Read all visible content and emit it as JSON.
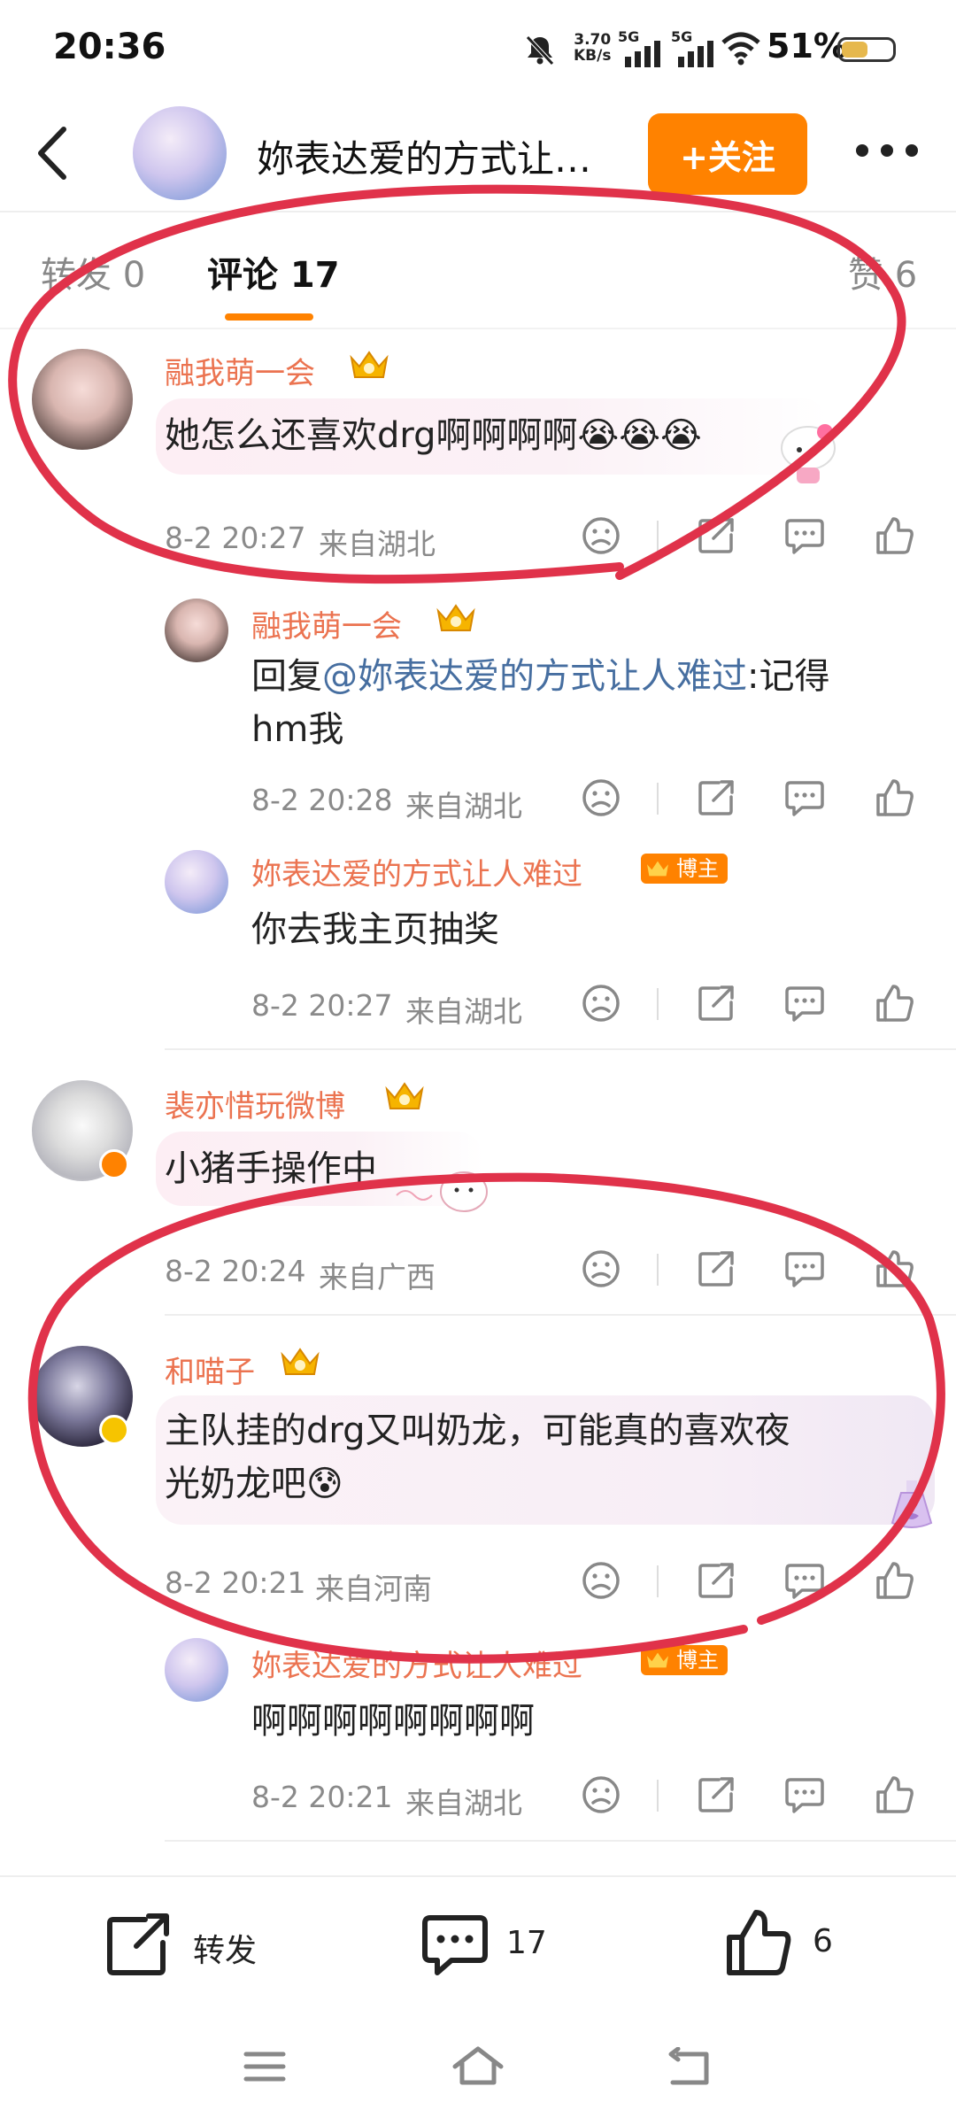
{
  "status_bar": {
    "time": "20:36",
    "net_speed_value": "3.70",
    "net_speed_unit": "KB/s",
    "signal1": "5G",
    "signal2": "5G",
    "battery": "51%",
    "battery_level": 0.51
  },
  "header": {
    "title": "妳表达爱的方式让…",
    "follow_label": "+关注"
  },
  "tabs": [
    {
      "label": "转发 0"
    },
    {
      "label": "评论 17"
    },
    {
      "label": "赞 6"
    }
  ],
  "comments": [
    {
      "name": "融我萌一会",
      "text": "她怎么还喜欢drg啊啊啊啊😭😭😭",
      "time": "8-2 20:27",
      "location": "来自湖北"
    },
    {
      "name": "融我萌一会",
      "reply_prefix": "回复",
      "mention": "@妳表达爱的方式让人难过",
      "text_line1": ":记得",
      "text_line2": "hm我",
      "time": "8-2 20:28",
      "location": "来自湖北"
    },
    {
      "name": "妳表达爱的方式让人难过",
      "badge": "博主",
      "text": "你去我主页抽奖",
      "time": "8-2 20:27",
      "location": "来自湖北"
    },
    {
      "name": "裴亦惜玩微博",
      "text": "小猪手操作中",
      "time": "8-2 20:24",
      "location": "来自广西"
    },
    {
      "name": "和喵子",
      "text_line1": "主队挂的drg又叫奶龙，可能真的喜欢夜",
      "text_line2": "光奶龙吧😰",
      "time": "8-2 20:21",
      "location": "来自河南"
    },
    {
      "name": "妳表达爱的方式让人难过",
      "badge": "博主",
      "text": "啊啊啊啊啊啊啊啊",
      "time": "8-2 20:21",
      "location": "来自湖北"
    }
  ],
  "bottom_bar": {
    "repost_label": "转发",
    "comment_count": "17",
    "like_count": "6"
  },
  "colors": {
    "accent": "#ff8200",
    "username": "#eb7350",
    "mention": "#466ea0",
    "annotation": "#e0324a"
  }
}
